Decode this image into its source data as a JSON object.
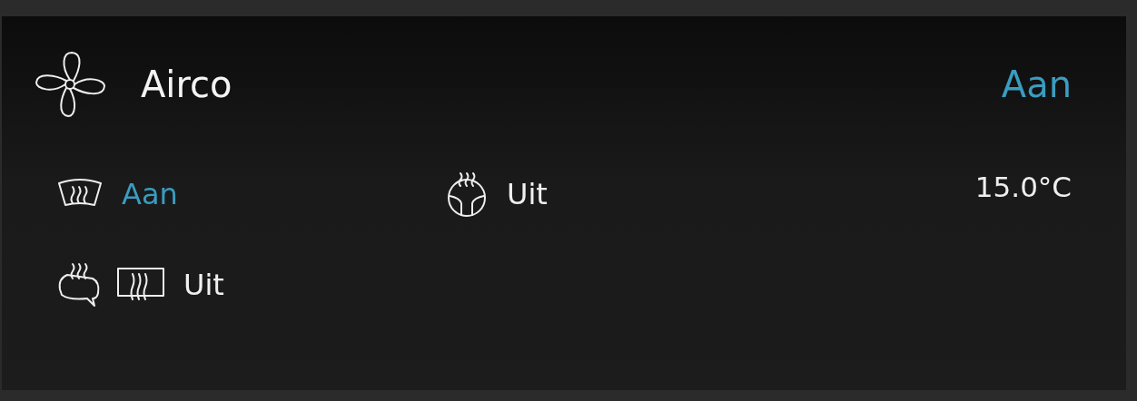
{
  "header": {
    "title": "Airco",
    "status": {
      "text": "Aan",
      "on": true
    }
  },
  "items": [
    {
      "kind": "front-defrost",
      "label": "Aan",
      "on": true
    },
    {
      "kind": "steering-heat",
      "label": "Uit",
      "on": false
    },
    {
      "kind": "seat-and-rear-defrost",
      "label": "Uit",
      "on": false
    }
  ],
  "temperature": "15.0°C"
}
